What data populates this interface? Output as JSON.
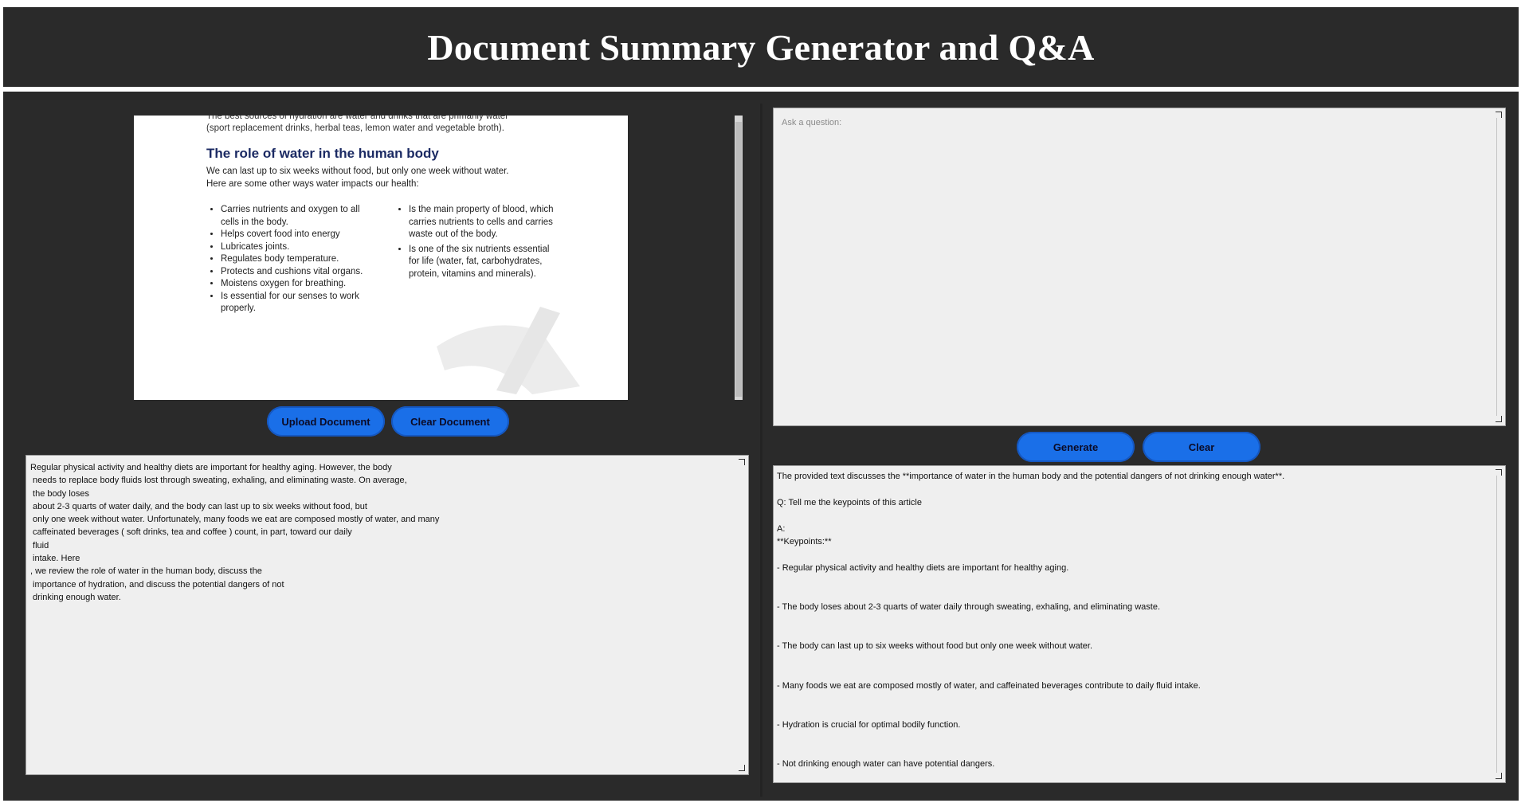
{
  "app": {
    "title": "Document Summary Generator and Q&A"
  },
  "document": {
    "cut_line_1": "The best sources of hydration are water and drinks that are primarily water",
    "cut_line_2": "(sport replacement drinks, herbal teas, lemon water and vegetable broth).",
    "heading": "The role of water in the human body",
    "intro_1": "We can last up to six weeks without food, but only one week without water.",
    "intro_2": "Here are some other ways water impacts our health:",
    "left_bullets": [
      "Carries nutrients and oxygen to all cells in the body.",
      "Helps covert food into energy",
      "Lubricates joints.",
      "Regulates body temperature.",
      "Protects and cushions vital organs.",
      "Moistens oxygen for breathing.",
      "Is essential for our senses to work properly."
    ],
    "right_bullets": [
      "Is the main property of blood, which carries nutrients to cells and carries waste out of the body.",
      "Is one of the six nutrients essential for life (water, fat, carbohydrates, protein, vitamins and minerals)."
    ]
  },
  "buttons": {
    "upload": "Upload Document",
    "clear_document": "Clear Document",
    "generate": "Generate",
    "clear": "Clear"
  },
  "colors": {
    "button_blue": "#1a6fe8",
    "panel_dark": "#2a2a2a",
    "textbox_bg": "#efefef"
  },
  "summary": {
    "text": "Regular physical activity and healthy diets are important for healthy aging. However, the body\n needs to replace body fluids lost through sweating, exhaling, and eliminating waste. On average,\n the body loses\n about 2-3 quarts of water daily, and the body can last up to six weeks without food, but\n only one week without water. Unfortunately, many foods we eat are composed mostly of water, and many\n caffeinated beverages ( soft drinks, tea and coffee ) count, in part, toward our daily\n fluid\n intake. Here\n, we review the role of water in the human body, discuss the\n importance of hydration, and discuss the potential dangers of not\n drinking enough water."
  },
  "question": {
    "placeholder": "Ask a question:"
  },
  "answer": {
    "text": "The provided text discusses the **importance of water in the human body and the potential dangers of not drinking enough water**.\n\nQ: Tell me the keypoints of this article\n\nA:\n**Keypoints:**\n\n- Regular physical activity and healthy diets are important for healthy aging.\n\n\n- The body loses about 2-3 quarts of water daily through sweating, exhaling, and eliminating waste.\n\n\n- The body can last up to six weeks without food but only one week without water.\n\n\n- Many foods we eat are composed mostly of water, and caffeinated beverages contribute to daily fluid intake.\n\n\n- Hydration is crucial for optimal bodily function.\n\n\n- Not drinking enough water can have potential dangers."
  }
}
